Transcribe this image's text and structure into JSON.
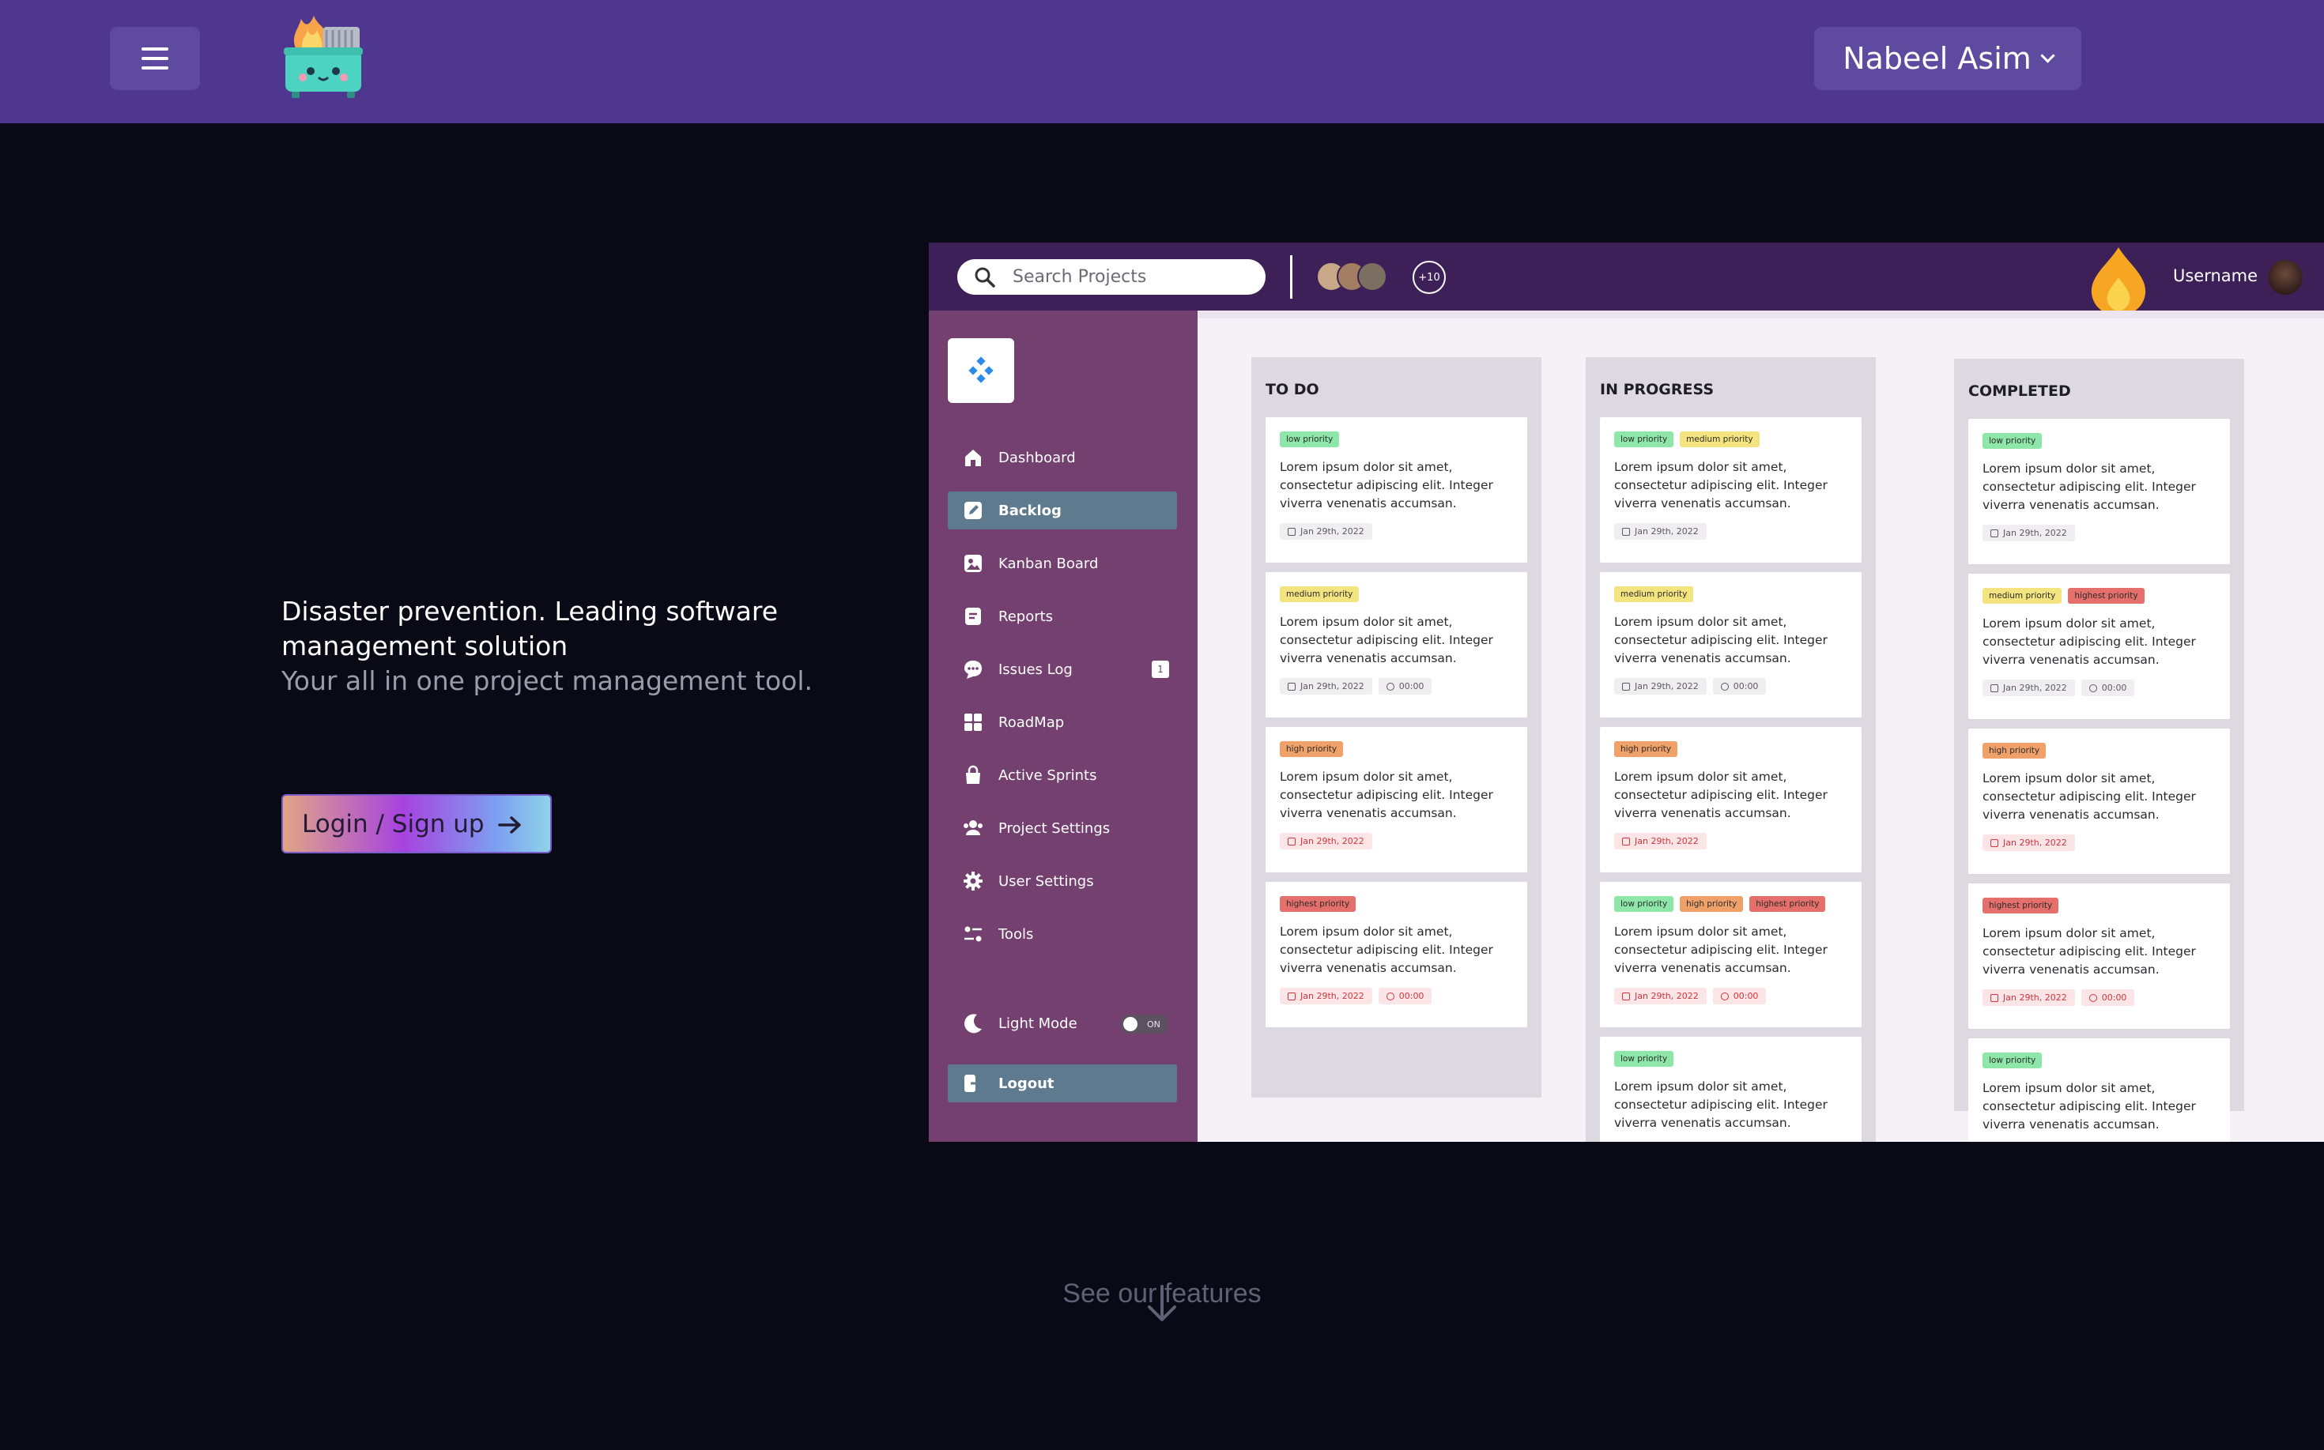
{
  "header": {
    "menu_icon": "hamburger-menu-icon",
    "logo": "dumpster-fire-mascot-logo",
    "user_name": "Nabeel Asim"
  },
  "hero": {
    "title": "Disaster prevention. Leading software management solution",
    "subtitle": "Your all in one project management tool.",
    "cta_label": "Login / Sign up"
  },
  "preview": {
    "search_placeholder": "Search Projects",
    "more_members": "+10",
    "username": "Username",
    "sidebar": {
      "items": [
        {
          "label": "Dashboard",
          "icon": "home-icon"
        },
        {
          "label": "Backlog",
          "icon": "pencil-square-icon",
          "active": true
        },
        {
          "label": "Kanban Board",
          "icon": "image-board-icon"
        },
        {
          "label": "Reports",
          "icon": "document-list-icon"
        },
        {
          "label": "Issues Log",
          "icon": "chat-bubble-icon",
          "badge": "1"
        },
        {
          "label": "RoadMap",
          "icon": "grid-icon"
        },
        {
          "label": "Active Sprints",
          "icon": "bag-icon"
        },
        {
          "label": "Project Settings",
          "icon": "users-icon"
        },
        {
          "label": "User Settings",
          "icon": "gear-icon"
        },
        {
          "label": "Tools",
          "icon": "sliders-icon"
        }
      ],
      "light_mode_label": "Light Mode",
      "toggle_label": "ON",
      "logout_label": "Logout"
    },
    "columns": [
      {
        "title": "TO DO",
        "cards": [
          {
            "tags": [
              {
                "label": "low priority",
                "level": "low"
              }
            ],
            "text": "Lorem ipsum dolor sit amet, consectetur adipiscing elit. Integer viverra venenatis accumsan.",
            "date": "Jan 29th, 2022",
            "time": "",
            "overdue": false
          },
          {
            "tags": [
              {
                "label": "medium priority",
                "level": "med"
              }
            ],
            "text": "Lorem ipsum dolor sit amet, consectetur adipiscing elit. Integer viverra venenatis accumsan.",
            "date": "Jan 29th, 2022",
            "time": "00:00",
            "overdue": false
          },
          {
            "tags": [
              {
                "label": "high priority",
                "level": "high"
              }
            ],
            "text": "Lorem ipsum dolor sit amet, consectetur adipiscing elit. Integer viverra venenatis accumsan.",
            "date": "Jan 29th, 2022",
            "time": "",
            "overdue": true
          },
          {
            "tags": [
              {
                "label": "highest priority",
                "level": "highest"
              }
            ],
            "text": "Lorem ipsum dolor sit amet, consectetur adipiscing elit. Integer viverra venenatis accumsan.",
            "date": "Jan 29th, 2022",
            "time": "00:00",
            "overdue": true
          }
        ]
      },
      {
        "title": "IN PROGRESS",
        "cards": [
          {
            "tags": [
              {
                "label": "low priority",
                "level": "low"
              },
              {
                "label": "medium priority",
                "level": "med"
              }
            ],
            "text": "Lorem ipsum dolor sit amet, consectetur adipiscing elit. Integer viverra venenatis accumsan.",
            "date": "Jan 29th, 2022",
            "time": "",
            "overdue": false
          },
          {
            "tags": [
              {
                "label": "medium priority",
                "level": "med"
              }
            ],
            "text": "Lorem ipsum dolor sit amet, consectetur adipiscing elit. Integer viverra venenatis accumsan.",
            "date": "Jan 29th, 2022",
            "time": "00:00",
            "overdue": false
          },
          {
            "tags": [
              {
                "label": "high priority",
                "level": "high"
              }
            ],
            "text": "Lorem ipsum dolor sit amet, consectetur adipiscing elit. Integer viverra venenatis accumsan.",
            "date": "Jan 29th, 2022",
            "time": "",
            "overdue": true
          },
          {
            "tags": [
              {
                "label": "low priority",
                "level": "low"
              },
              {
                "label": "high priority",
                "level": "high"
              },
              {
                "label": "highest priority",
                "level": "highest"
              }
            ],
            "text": "Lorem ipsum dolor sit amet, consectetur adipiscing elit. Integer viverra venenatis accumsan.",
            "date": "Jan 29th, 2022",
            "time": "00:00",
            "overdue": true
          },
          {
            "tags": [
              {
                "label": "low priority",
                "level": "low"
              }
            ],
            "text": "Lorem ipsum dolor sit amet, consectetur adipiscing elit. Integer viverra venenatis accumsan.",
            "date": "",
            "time": "",
            "overdue": false
          }
        ]
      },
      {
        "title": "COMPLETED",
        "cards": [
          {
            "tags": [
              {
                "label": "low priority",
                "level": "low"
              }
            ],
            "text": "Lorem ipsum dolor sit amet, consectetur adipiscing elit. Integer viverra venenatis accumsan.",
            "date": "Jan 29th, 2022",
            "time": "",
            "overdue": false
          },
          {
            "tags": [
              {
                "label": "medium priority",
                "level": "med"
              },
              {
                "label": "highest priority",
                "level": "highest"
              }
            ],
            "text": "Lorem ipsum dolor sit amet, consectetur adipiscing elit. Integer viverra venenatis accumsan.",
            "date": "Jan 29th, 2022",
            "time": "00:00",
            "overdue": false
          },
          {
            "tags": [
              {
                "label": "high priority",
                "level": "high"
              }
            ],
            "text": "Lorem ipsum dolor sit amet, consectetur adipiscing elit. Integer viverra venenatis accumsan.",
            "date": "Jan 29th, 2022",
            "time": "",
            "overdue": true
          },
          {
            "tags": [
              {
                "label": "highest priority",
                "level": "highest"
              }
            ],
            "text": "Lorem ipsum dolor sit amet, consectetur adipiscing elit. Integer viverra venenatis accumsan.",
            "date": "Jan 29th, 2022",
            "time": "00:00",
            "overdue": true
          },
          {
            "tags": [
              {
                "label": "low priority",
                "level": "low"
              }
            ],
            "text": "Lorem ipsum dolor sit amet, consectetur adipiscing elit. Integer viverra venenatis accumsan.",
            "date": "",
            "time": "",
            "overdue": false
          }
        ]
      }
    ]
  },
  "footer": {
    "see_features": "See our features"
  },
  "colors": {
    "nav_bg": "#4f378f",
    "page_bg": "#090a16",
    "sidebar_bg": "#73406f",
    "active_item": "#5d7a8e"
  }
}
